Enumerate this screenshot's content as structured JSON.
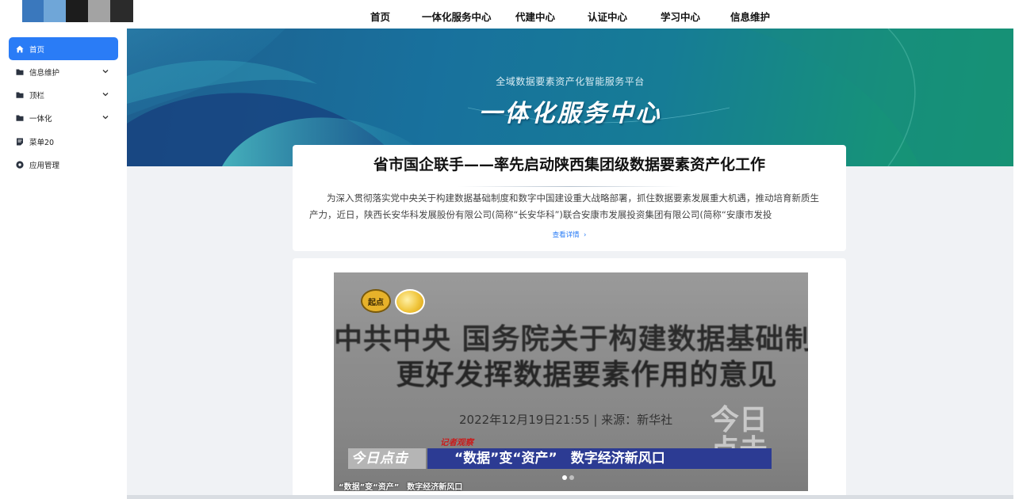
{
  "topnav": {
    "items": [
      {
        "label": "首页"
      },
      {
        "label": "一体化服务中心"
      },
      {
        "label": "代建中心"
      },
      {
        "label": "认证中心"
      },
      {
        "label": "学习中心"
      },
      {
        "label": "信息维护"
      }
    ]
  },
  "sidebar": {
    "items": [
      {
        "label": "首页",
        "icon": "home-icon",
        "active": true
      },
      {
        "label": "信息维护",
        "icon": "folder-icon",
        "expandable": true
      },
      {
        "label": "顶栏",
        "icon": "folder-icon",
        "expandable": true
      },
      {
        "label": "一体化",
        "icon": "folder-icon",
        "expandable": true
      },
      {
        "label": "菜单20",
        "icon": "document-icon"
      },
      {
        "label": "应用管理",
        "icon": "settings-icon"
      }
    ]
  },
  "banner": {
    "subtitle": "全域数据要素资产化智能服务平台",
    "title": "一体化服务中心"
  },
  "news": {
    "title": "省市国企联手——率先启动陕西集团级数据要素资产化工作",
    "body": "为深入贯彻落实党中央关于构建数据基础制度和数字中国建设重大战略部署，抓住数据要素发展重大机遇，推动培育新质生产力，近日，陕西长安华科发展股份有限公司(简称“长安华科”)联合安康市发展投资集团有限公司(简称“安康市发投",
    "more_label": "查看详情"
  },
  "video": {
    "line1": "中共中央 国务院关于构建数据基础制度",
    "line2": "更好发挥数据要素作用的意见",
    "date": "2022年12月19日21:55 | 来源：新华社",
    "watermark": "今日点击",
    "badge1": "起点",
    "ticker_left": "今日点击",
    "ticker_tag": "记者观察",
    "ticker": "“数据”变“资产”　数字经济新风口",
    "caption": "“数据”变“资产”　数字经济新风口",
    "slide_count": 2,
    "active_slide": 1
  },
  "colors": {
    "accent": "#2a7cf6",
    "banner_start": "#1f5f8f",
    "banner_end": "#14976e",
    "ticker_blue": "#2c3b93"
  }
}
